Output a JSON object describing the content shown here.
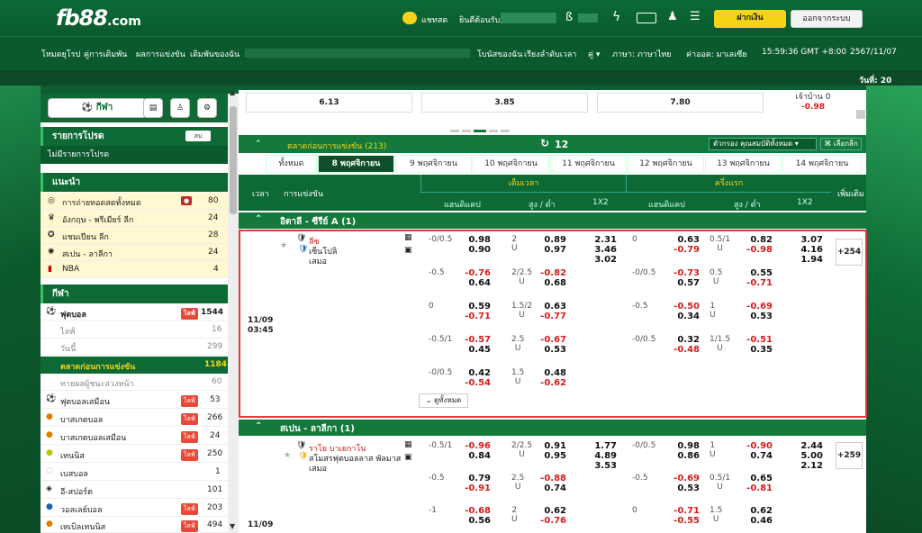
{
  "header": {
    "logo_main": "fb88",
    "logo_suffix": ".com",
    "chat": "แชทสด",
    "welcome": "ยินดีต้อนรับ,",
    "deposit": "ฝากเงิน",
    "logout": "ออกจากระบบ"
  },
  "nav": {
    "left": [
      "โหมดยุโรป",
      "คู่การเดิมพัน",
      "ผลการแข่งขัน",
      "เดิมพันของฉัน"
    ],
    "bonus": "โบนัสของฉัน",
    "results": "เรียงลำดับเวลา",
    "lang": "ภาษา: ภาษาไทย",
    "odds": "ค่าออด: มาเลเซีย",
    "time": "15:59:36 GMT +8:00",
    "date": "2567/11/07",
    "today": "วันที่: 20"
  },
  "sidebar": {
    "sports": "กีฬา",
    "fav_title": "รายการโปรด",
    "fav_btn": "ลบ",
    "fav_empty": "ไม่มีรายการโปรด",
    "rec_title": "แนะนำ",
    "rec": [
      {
        "name": "การถ่ายทอดสดทั้งหมด",
        "count": "80"
      },
      {
        "name": "อังกฤษ - พรีเมียร์ ลีก",
        "count": "24"
      },
      {
        "name": "แชมเปียน ลีก",
        "count": "28"
      },
      {
        "name": "สเปน - ลาลีกา",
        "count": "24"
      },
      {
        "name": "NBA",
        "count": "4"
      }
    ],
    "sports_title": "กีฬา",
    "list": [
      {
        "name": "ฟุตบอล",
        "count": "1544"
      },
      {
        "name": "ไลฟ์",
        "count": "16"
      },
      {
        "name": "วันนี้",
        "count": "299"
      },
      {
        "name": "ตลาดก่อนการแข่งขัน",
        "count": "1184"
      },
      {
        "name": "ทายผลผู้ชนะล่วงหน้า",
        "count": "60"
      },
      {
        "name": "ฟุตบอลเสมือน",
        "count": "53"
      },
      {
        "name": "บาสเกตบอล",
        "count": "266"
      },
      {
        "name": "บาสเกตบอลเสมือน",
        "count": "24"
      },
      {
        "name": "เทนนิส",
        "count": "250"
      },
      {
        "name": "เบสบอล",
        "count": "1"
      },
      {
        "name": "อี-สปอร์ต",
        "count": "101"
      },
      {
        "name": "วอลเลย์บอล",
        "count": "203"
      },
      {
        "name": "เทเบิลเทนนิส",
        "count": "494"
      }
    ],
    "live_label": "ไลฟ์"
  },
  "top_odds": [
    "6.13",
    "3.85",
    "7.80",
    "เจ้าบ้าน 0",
    "-0.98"
  ],
  "market": {
    "title": "ตลาดก่อนการแข่งขัน (213)",
    "refresh": "12",
    "filter": "ตัวกรอง คุณสมบัติทั้งหมด",
    "select_league": "เลือกลีก",
    "tabs": [
      "ทั้งหมด",
      "8 พฤศจิกายน",
      "9 พฤศจิกายน",
      "10 พฤศจิกายน",
      "11 พฤศจิกายน",
      "12 พฤศจิกายน",
      "13 พฤศจิกายน",
      "14 พฤศจิกายน"
    ],
    "col_time": "เวลา",
    "col_event": "การแข่งขัน",
    "col_full": "เต็มเวลา",
    "col_half": "ครึ่งแรก",
    "col_hdp": "แฮนดิแคป",
    "col_ou": "สูง / ต่ำ",
    "col_1x2": "1X2",
    "col_more": "เพิ่มเติม"
  },
  "match1": {
    "league": "อิตาลี - ซีรีย์ A (1)",
    "home": "ลีซ",
    "away": "เซ็นโปลิ",
    "draw": "เสมอ",
    "time": "11/09",
    "clock": "03:45",
    "more": "+254",
    "more_btn": "ดูทั้งหมด",
    "rows": [
      {
        "fh": "-0/0.5",
        "fo": [
          "0.98",
          "0.90"
        ],
        "ou": "2\nU",
        "oo": [
          "0.89",
          "0.97"
        ],
        "x12": "2.31\n3.46\n3.02",
        "hh": "0",
        "ho": [
          "0.63",
          "-0.79"
        ],
        "hou": "0.5/1\nU",
        "hoo": [
          "0.82",
          "-0.98"
        ],
        "hx": "3.07\n4.16\n1.94"
      },
      {
        "fh": "-0.5",
        "fo": [
          "-0.76",
          "0.64"
        ],
        "ou": "2/2.5\nU",
        "oo": [
          "-0.82",
          "0.68"
        ],
        "hh": "-0/0.5",
        "ho": [
          "-0.73",
          "0.57"
        ],
        "hou": "0.5\nU",
        "hoo": [
          "0.55",
          "-0.71"
        ]
      },
      {
        "fh": "0",
        "fo": [
          "0.59",
          "-0.71"
        ],
        "ou": "1.5/2\nU",
        "oo": [
          "0.63",
          "-0.77"
        ],
        "hh": "-0.5",
        "ho": [
          "-0.50",
          "0.34"
        ],
        "hou": "1\nU",
        "hoo": [
          "-0.69",
          "0.53"
        ]
      },
      {
        "fh": "-0.5/1",
        "fo": [
          "-0.57",
          "0.45"
        ],
        "ou": "2.5\nU",
        "oo": [
          "-0.67",
          "0.53"
        ],
        "hh": "-0/0.5",
        "ho": [
          "0.32",
          "-0.48"
        ],
        "hou": "1/1.5\nU",
        "hoo": [
          "-0.51",
          "0.35"
        ]
      },
      {
        "fh": "-0/0.5",
        "fo": [
          "0.42",
          "-0.54"
        ],
        "ou": "1.5\nU",
        "oo": [
          "0.48",
          "-0.62"
        ]
      }
    ]
  },
  "match2": {
    "league": "สเปน - ลาลีกา (1)",
    "home": "ราโย บาเยกาโน",
    "away": "สโมสรฟุตบอลลาส พัลมาส",
    "draw": "เสมอ",
    "time": "11/09",
    "more": "+259",
    "rows": [
      {
        "fh": "-0.5/1",
        "fo": [
          "-0.96",
          "0.84"
        ],
        "ou": "2/2.5\nU",
        "oo": [
          "0.91",
          "0.95"
        ],
        "x12": "1.77\n4.89\n3.53",
        "hh": "-0/0.5",
        "ho": [
          "0.98",
          "0.86"
        ],
        "hou": "1\nU",
        "hoo": [
          "-0.90",
          "0.74"
        ],
        "hx": "2.44\n5.00\n2.12"
      },
      {
        "fh": "-0.5",
        "fo": [
          "0.79",
          "-0.91"
        ],
        "ou": "2.5\nU",
        "oo": [
          "-0.88",
          "0.74"
        ],
        "hh": "-0.5",
        "ho": [
          "-0.69",
          "0.53"
        ],
        "hou": "0.5/1\nU",
        "hoo": [
          "0.65",
          "-0.81"
        ]
      },
      {
        "fh": "-1",
        "fo": [
          "-0.68",
          "0.56"
        ],
        "ou": "2\nU",
        "oo": [
          "0.62",
          "-0.76"
        ],
        "hh": "0",
        "ho": [
          "-0.71",
          "-0.55"
        ],
        "hou": "1.5\nU",
        "hoo": [
          "0.62",
          "0.46"
        ]
      }
    ]
  }
}
